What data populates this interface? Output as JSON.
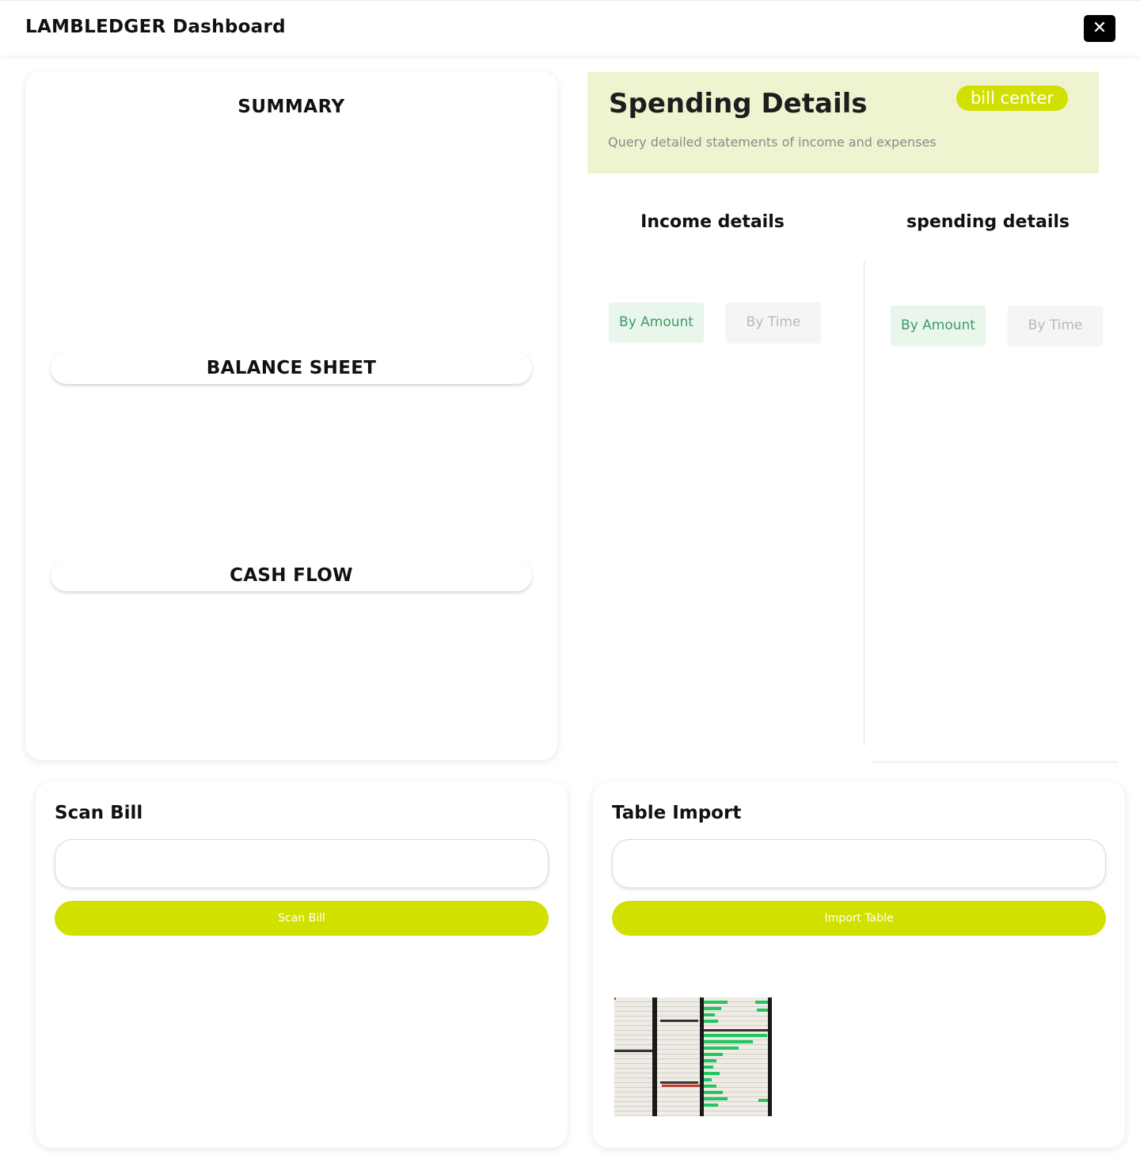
{
  "header": {
    "title": "LAMBLEDGER Dashboard",
    "close_icon": "close-icon"
  },
  "summary": {
    "title": "SUMMARY",
    "balance_sheet": "BALANCE SHEET",
    "cash_flow": "CASH FLOW"
  },
  "spending": {
    "title": "Spending Details",
    "subtitle": "Query detailed statements of income and expenses",
    "badge": "bill center",
    "income_heading": "Income details",
    "spending_heading": "spending details",
    "income_tabs": [
      {
        "label": "By Amount",
        "active": true
      },
      {
        "label": "By Time",
        "active": false
      }
    ],
    "spending_tabs": [
      {
        "label": "By Amount",
        "active": true
      },
      {
        "label": "By Time",
        "active": false
      }
    ]
  },
  "scan_bill": {
    "title": "Scan Bill",
    "button": "Scan Bill"
  },
  "table_import": {
    "title": "Table Import",
    "button": "Import Table"
  },
  "colors": {
    "accent": "#d2e000",
    "banner": "#eff3cf",
    "tab_active_text": "#3f9a63",
    "tab_active_bg": "#e8f6ec"
  }
}
